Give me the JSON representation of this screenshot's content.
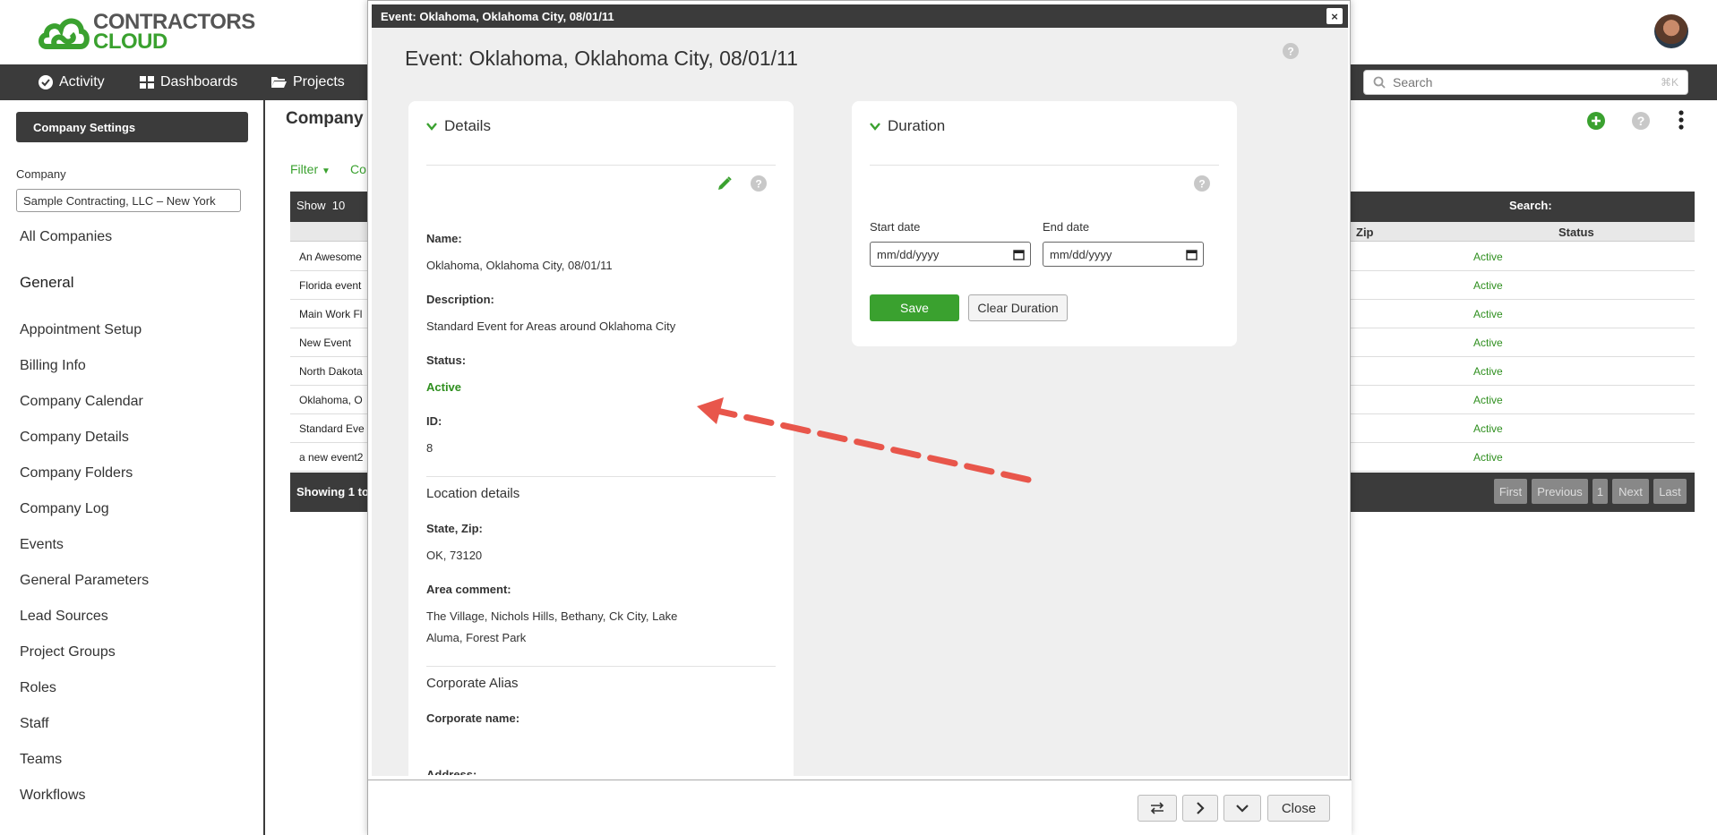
{
  "logo": {
    "line1": "CONTRACTORS",
    "line2": "CLOUD"
  },
  "nav": {
    "activity": "Activity",
    "dashboards": "Dashboards",
    "projects": "Projects",
    "search_placeholder": "Search",
    "search_shortcut": "⌘K"
  },
  "sidebar": {
    "settings_button": "Company Settings",
    "company_label": "Company",
    "company_value": "Sample Contracting, LLC – New York",
    "all_companies": "All Companies",
    "general": "General",
    "items": [
      "Appointment Setup",
      "Billing Info",
      "Company Calendar",
      "Company Details",
      "Company Folders",
      "Company Log",
      "Events",
      "General Parameters",
      "Lead Sources",
      "Project Groups",
      "Roles",
      "Staff",
      "Teams",
      "Workflows"
    ]
  },
  "background_page": {
    "title": "Company",
    "filter": "Filter",
    "co": "Co",
    "show_label": "Show",
    "show_value": "10",
    "search_label": "Search:",
    "columns": {
      "zip": "Zip",
      "status": "Status"
    },
    "rows": [
      {
        "name": "An Awesome",
        "status": "Active"
      },
      {
        "name": "Florida event",
        "status": "Active"
      },
      {
        "name": "Main Work Fl",
        "status": "Active"
      },
      {
        "name": "New Event",
        "status": "Active"
      },
      {
        "name": "North Dakota",
        "status": "Active"
      },
      {
        "name": "Oklahoma, O",
        "status": "Active"
      },
      {
        "name": "Standard Eve",
        "status": "Active"
      },
      {
        "name": "a new event2",
        "status": "Active"
      }
    ],
    "showing": "Showing 1 to",
    "pager": {
      "first": "First",
      "previous": "Previous",
      "page": "1",
      "next": "Next",
      "last": "Last"
    }
  },
  "modal": {
    "titlebar": "Event: Oklahoma, Oklahoma City, 08/01/11",
    "close_x": "×",
    "heading": "Event: Oklahoma, Oklahoma City, 08/01/11",
    "details": {
      "title": "Details",
      "name_label": "Name:",
      "name_value": "Oklahoma, Oklahoma City, 08/01/11",
      "description_label": "Description:",
      "description_value": "Standard Event for Areas around Oklahoma City",
      "status_label": "Status:",
      "status_value": "Active",
      "id_label": "ID:",
      "id_value": "8",
      "location_title": "Location details",
      "state_zip_label": "State, Zip:",
      "state_zip_value": "OK, 73120",
      "area_comment_label": "Area comment:",
      "area_comment_line1": "The Village, Nichols Hills, Bethany, Ck City, Lake",
      "area_comment_line2": "Aluma, Forest Park",
      "corporate_title": "Corporate Alias",
      "corporate_name_label": "Corporate name:",
      "address_label": "Address:"
    },
    "duration": {
      "title": "Duration",
      "start_label": "Start date",
      "end_label": "End date",
      "start_placeholder": "mm/dd/yyyy",
      "end_placeholder": "mm/dd/yyyy",
      "save": "Save",
      "clear": "Clear Duration"
    },
    "footer": {
      "close": "Close"
    }
  },
  "colors": {
    "brand_green": "#3aa12f",
    "dark_bar": "#3b3b3b",
    "annotation_arrow": "#e8564b"
  }
}
